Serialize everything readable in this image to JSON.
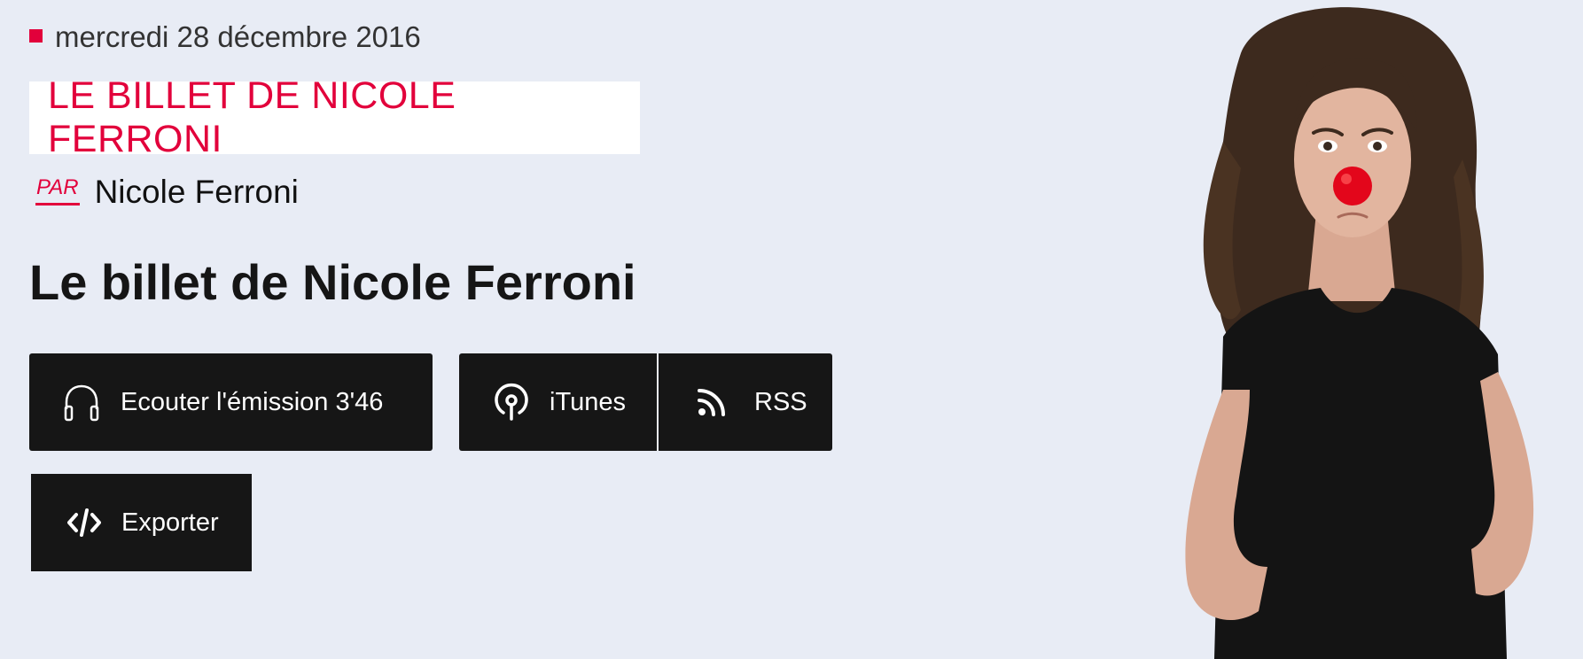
{
  "header": {
    "date": "mercredi 28 décembre 2016",
    "show_tag": "LE BILLET DE NICOLE FERRONI"
  },
  "author": {
    "prefix": "PAR",
    "name": "Nicole Ferroni"
  },
  "episode": {
    "title": "Le billet de Nicole Ferroni"
  },
  "actions": {
    "listen_label": "Ecouter l'émission 3'46",
    "itunes_label": "iTunes",
    "rss_label": "RSS",
    "export_label": "Exporter"
  },
  "icons": {
    "listen": "headphones-icon",
    "itunes": "podcast-icon",
    "rss": "rss-icon",
    "export": "code-icon"
  },
  "colors": {
    "accent": "#e2003b",
    "background": "#e8ecf5",
    "button": "#161616"
  }
}
